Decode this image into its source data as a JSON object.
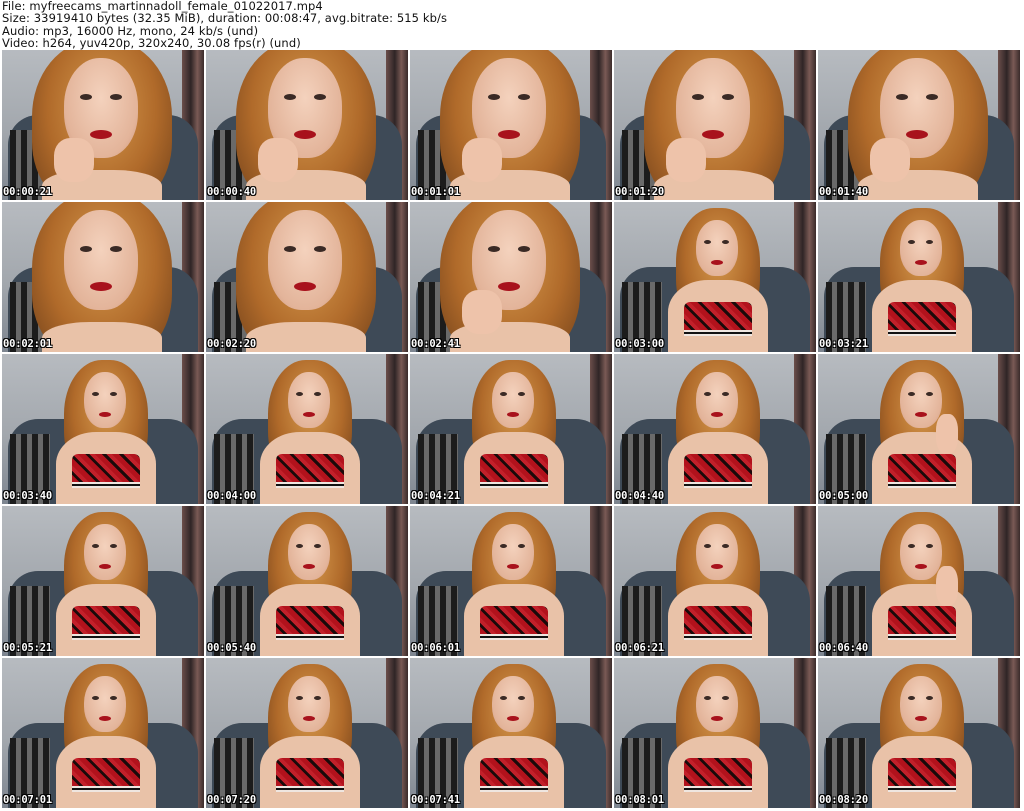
{
  "header": {
    "file": "File: myfreecams_martinnadoll_female_01022017.mp4",
    "size": "Size: 33919410 bytes (32.35 MiB), duration: 00:08:47, avg.bitrate: 515 kb/s",
    "audio": "Audio: mp3, 16000 Hz, mono, 24 kb/s (und)",
    "video": "Video: h264, yuv420p, 320x240, 30.08 fps(r) (und)"
  },
  "thumbnails": [
    {
      "timestamp": "00:00:21",
      "scene": "closeup-hand"
    },
    {
      "timestamp": "00:00:40",
      "scene": "closeup-hand"
    },
    {
      "timestamp": "00:01:01",
      "scene": "closeup-hand"
    },
    {
      "timestamp": "00:01:20",
      "scene": "closeup-hand"
    },
    {
      "timestamp": "00:01:40",
      "scene": "closeup-hand"
    },
    {
      "timestamp": "00:02:01",
      "scene": "closeup"
    },
    {
      "timestamp": "00:02:20",
      "scene": "closeup"
    },
    {
      "timestamp": "00:02:41",
      "scene": "closeup-hand"
    },
    {
      "timestamp": "00:03:00",
      "scene": "seated"
    },
    {
      "timestamp": "00:03:21",
      "scene": "seated"
    },
    {
      "timestamp": "00:03:40",
      "scene": "seated"
    },
    {
      "timestamp": "00:04:00",
      "scene": "seated"
    },
    {
      "timestamp": "00:04:21",
      "scene": "seated"
    },
    {
      "timestamp": "00:04:40",
      "scene": "seated"
    },
    {
      "timestamp": "00:05:00",
      "scene": "seated-hand"
    },
    {
      "timestamp": "00:05:21",
      "scene": "seated"
    },
    {
      "timestamp": "00:05:40",
      "scene": "seated"
    },
    {
      "timestamp": "00:06:01",
      "scene": "seated"
    },
    {
      "timestamp": "00:06:21",
      "scene": "seated"
    },
    {
      "timestamp": "00:06:40",
      "scene": "seated-hand"
    },
    {
      "timestamp": "00:07:01",
      "scene": "seated"
    },
    {
      "timestamp": "00:07:20",
      "scene": "seated"
    },
    {
      "timestamp": "00:07:41",
      "scene": "seated"
    },
    {
      "timestamp": "00:08:01",
      "scene": "seated"
    },
    {
      "timestamp": "00:08:20",
      "scene": "seated"
    }
  ],
  "colors": {
    "background": "#ffffff",
    "header_text": "#111111",
    "timestamp_text": "#ffffff",
    "timestamp_outline": "#000000"
  }
}
